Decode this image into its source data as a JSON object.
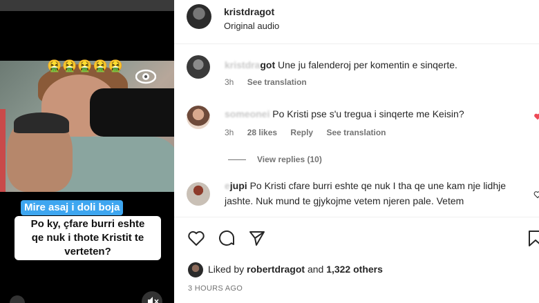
{
  "video": {
    "emoji_row": "🤮🤮🤮🤮🤮",
    "caption_line1": "Mire asaj i doli boja",
    "caption_line2": [
      "Po ky, çfare burri eshte",
      "qe nuk i thote Kristit te",
      "verteten?"
    ],
    "icons": {
      "mute": "speaker-muted-icon",
      "logo": "eye-logo-icon"
    }
  },
  "post": {
    "username": "kristdragot",
    "audio": "Original audio"
  },
  "comments": [
    {
      "name_visible": "got",
      "name_blurred": "kristdra",
      "text": "Une ju falenderoj per komentin e sinqerte.",
      "time": "3h",
      "see_translation": "See translation"
    },
    {
      "name_blurred": "someone",
      "name_visible": "i",
      "text": "Po Kristi pse s'u tregua i sinqerte me Keisin?",
      "time": "3h",
      "likes": "28 likes",
      "reply": "Reply",
      "see_translation": "See translation",
      "view_replies": "View replies (10)"
    },
    {
      "name_blurred": "e",
      "name_visible": "jupi",
      "text": "Po Kristi cfare burri eshte qe nuk I tha qe une kam nje lidhje jashte. Nuk mund te gjykojme vetem njeren pale. Vetem"
    }
  ],
  "actions": {
    "icons": [
      "heart-icon",
      "comment-icon",
      "share-icon",
      "bookmark-icon"
    ]
  },
  "likes": {
    "prefix": "Liked by",
    "user": "robertdragot",
    "and": "and",
    "others": "1,322 others"
  },
  "timestamp": "3 HOURS AGO",
  "colors": {
    "caption_blue": "#3ea6f0",
    "like_red": "#ed4956",
    "muted_text": "#737373"
  }
}
